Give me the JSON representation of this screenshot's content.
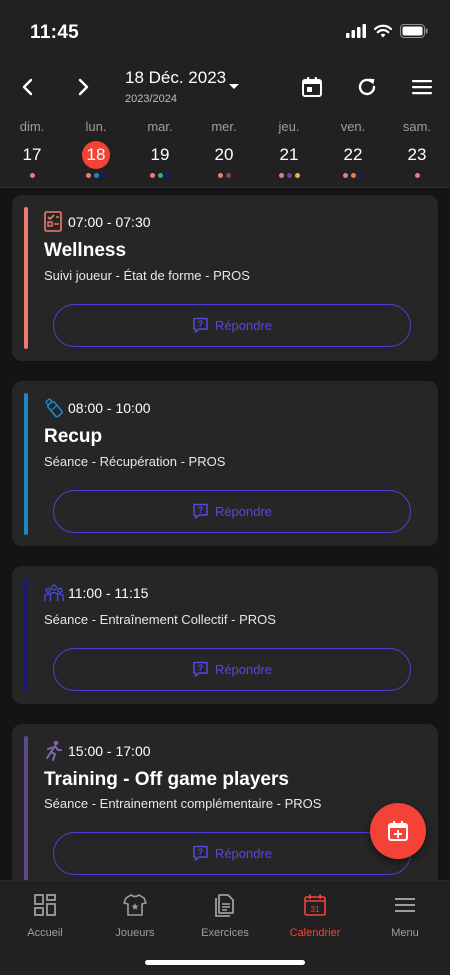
{
  "status_bar": {
    "time": "11:45"
  },
  "header": {
    "date_label": "18 Déc. 2023",
    "season_label": "2023/2024",
    "prev_icon": "chevron-left-icon",
    "next_icon": "chevron-right-icon",
    "calendar_icon": "calendar-icon",
    "refresh_icon": "refresh-icon",
    "menu_icon": "hamburger-menu-icon"
  },
  "week": {
    "days": [
      {
        "name": "dim.",
        "num": "17",
        "selected": false,
        "dots": [
          "#ef7a6f"
        ]
      },
      {
        "name": "lun.",
        "num": "18",
        "selected": true,
        "dots": [
          "#ef7a6f",
          "#1e88c7",
          "#1a1b6e"
        ]
      },
      {
        "name": "mar.",
        "num": "19",
        "selected": false,
        "dots": [
          "#ef7a6f",
          "#2bb673",
          "#1a1b6e"
        ]
      },
      {
        "name": "mer.",
        "num": "20",
        "selected": false,
        "dots": [
          "#ef7a6f",
          "#8e3f6b"
        ]
      },
      {
        "name": "jeu.",
        "num": "21",
        "selected": false,
        "dots": [
          "#ef7a6f",
          "#6a3fa8",
          "#f0b429"
        ]
      },
      {
        "name": "ven.",
        "num": "22",
        "selected": false,
        "dots": [
          "#ef7a6f",
          "#f57c2a",
          "#1a1b6e"
        ]
      },
      {
        "name": "sam.",
        "num": "23",
        "selected": false,
        "dots": [
          "#ef7a6f"
        ]
      }
    ]
  },
  "events": [
    {
      "time": "07:00 - 07:30",
      "title": "Wellness",
      "subtitle": "Suivi joueur - État de forme - PROS",
      "bar_color": "#f07a70",
      "icon": "checklist-icon",
      "button_label": "Répondre"
    },
    {
      "time": "08:00 - 10:00",
      "title": "Recup",
      "subtitle": "Séance - Récupération - PROS",
      "bar_color": "#1e88c7",
      "icon": "water-bottle-icon",
      "button_label": "Répondre"
    },
    {
      "time": "11:00 - 11:15",
      "title": "",
      "subtitle": "Séance - Entraînement Collectif - PROS",
      "bar_color": "#1a1b6e",
      "icon": "team-group-icon",
      "button_label": "Répondre"
    },
    {
      "time": "15:00 - 17:00",
      "title": "Training - Off game players",
      "subtitle": "Séance - Entrainement complémentaire - PROS",
      "bar_color": "#5e4a86",
      "icon": "runner-icon",
      "button_label": "Répondre"
    }
  ],
  "fab": {
    "icon": "add-event-icon"
  },
  "bottom_nav": {
    "items": [
      {
        "label": "Accueil",
        "icon": "dashboard-icon",
        "active": false
      },
      {
        "label": "Joueurs",
        "icon": "jersey-icon",
        "active": false
      },
      {
        "label": "Exercices",
        "icon": "document-icon",
        "active": false
      },
      {
        "label": "Calendrier",
        "icon": "calendar-31-icon",
        "active": true,
        "calendar_day": "31"
      },
      {
        "label": "Menu",
        "icon": "hamburger-menu-icon",
        "active": false
      }
    ]
  },
  "colors": {
    "accent": "#f44336",
    "button_outline": "#4d3fd6",
    "card_bg": "#262626",
    "app_bg": "#141414"
  }
}
